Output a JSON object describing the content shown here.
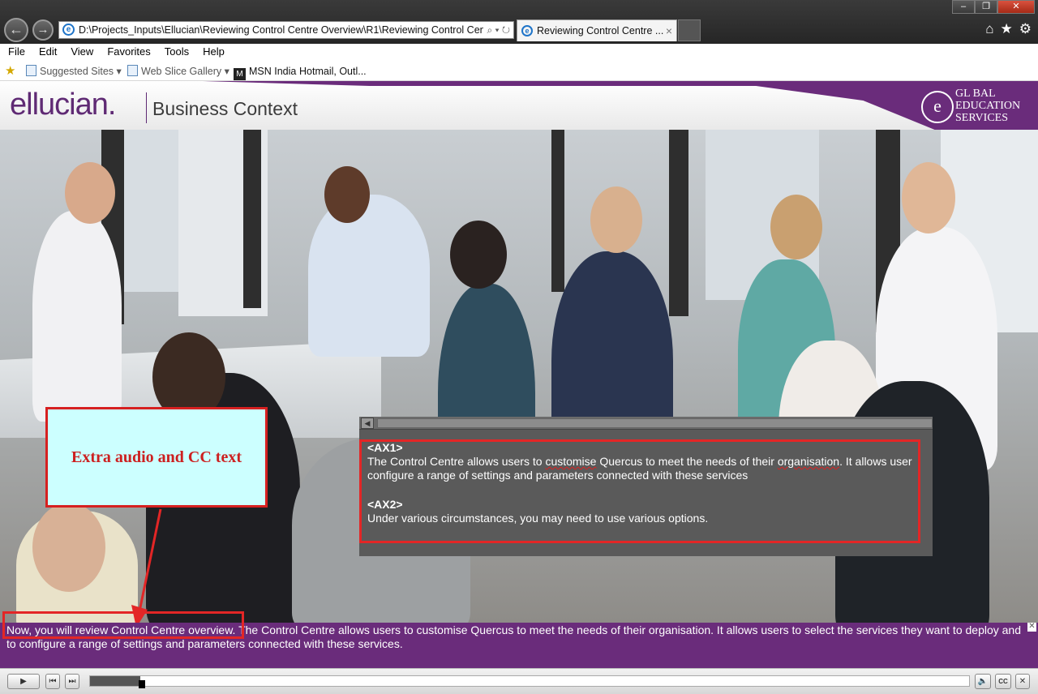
{
  "browser": {
    "address": "D:\\Projects_Inputs\\Ellucian\\Reviewing Control Centre Overview\\R1\\Reviewing Control Cent",
    "tab_title": "Reviewing Control Centre ...",
    "menu": [
      "File",
      "Edit",
      "View",
      "Favorites",
      "Tools",
      "Help"
    ],
    "favorites": {
      "suggested_sites": "Suggested Sites",
      "web_slice_gallery": "Web Slice Gallery",
      "msn": "MSN India",
      "hotmail": "Hotmail, Outl..."
    }
  },
  "course": {
    "logo": "ellucian.",
    "title": "Business Context",
    "brand_line1": "GL  BAL",
    "brand_line2": "EDUCATION",
    "brand_line3": "SERVICES"
  },
  "callout": {
    "text": "Extra audio and CC text"
  },
  "audio_panel": {
    "ax1_tag": "<AX1>",
    "ax1_part1": "The Control Centre allows users to ",
    "ax1_word1": "customise",
    "ax1_part2": " Quercus to meet the needs of their ",
    "ax1_word2": "organisation",
    "ax1_part3": ". It allows user",
    "ax1_line2": "configure a range of settings and parameters connected with these services",
    "ax2_tag": "<AX2>",
    "ax2_text": "Under various circumstances, you may need to use various options."
  },
  "caption": {
    "text": "Now, you will review Control Centre overview.  The Control Centre allows users to customise Quercus to meet the needs of their organisation. It allows users to select the services they want to deploy and to configure a range of settings and parameters connected with these services.",
    "close": "✕"
  },
  "player": {
    "progress_fraction": 0.057,
    "cc_label": "CC"
  },
  "colors": {
    "brand_purple": "#6a2c7b",
    "highlight_red": "#e32626",
    "callout_bg": "#ccffff"
  }
}
